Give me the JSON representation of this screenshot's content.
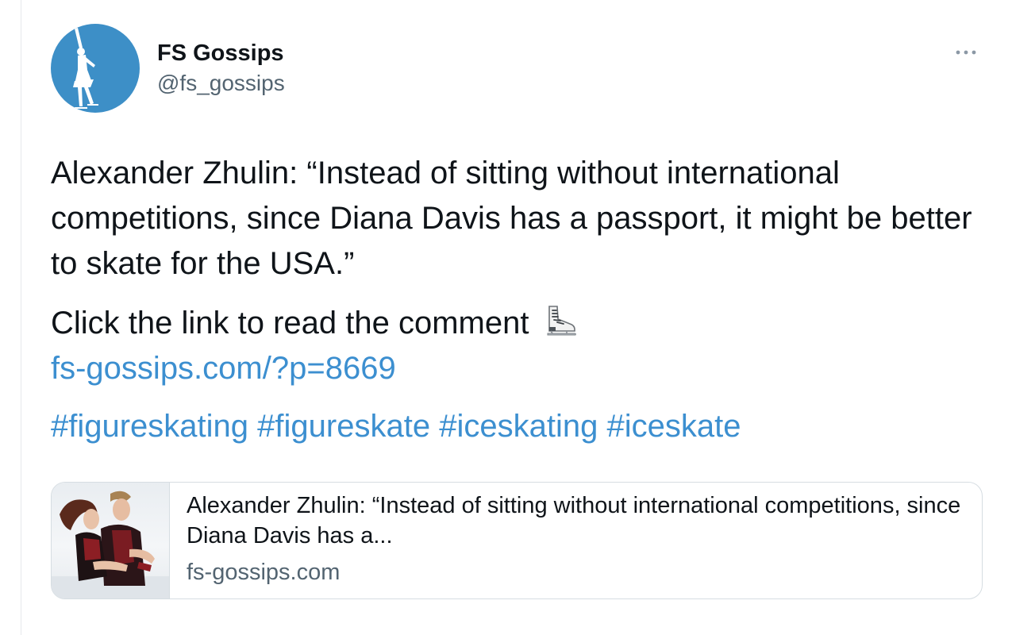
{
  "tweet": {
    "author": {
      "display_name": "FS Gossips",
      "handle": "@fs_gossips",
      "avatar_color": "#3d8fc7"
    },
    "text_paragraph_1": "Alexander Zhulin: “Instead of sitting without international competitions, since Diana Davis has a passport, it might be better to skate for the USA.”",
    "text_paragraph_2": "Click the link to read the comment",
    "emoji": "ice-skate-icon",
    "link": "fs-gossips.com/?p=8669",
    "hashtags": [
      "#figureskating",
      "#figureskate",
      "#iceskating",
      "#iceskate"
    ],
    "link_color": "#3c8fd0",
    "more_icon": "more-horizontal-icon"
  },
  "card": {
    "title": "Alexander Zhulin: “Instead of sitting without international competitions, since Diana Davis has a...",
    "domain": "fs-gossips.com"
  }
}
